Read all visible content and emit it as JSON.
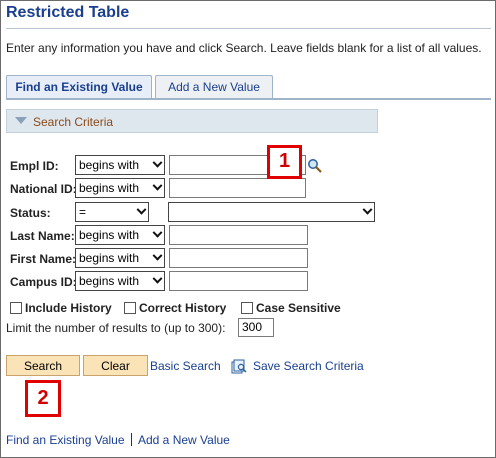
{
  "page": {
    "title": "Restricted Table",
    "instructions": "Enter any information you have and click Search. Leave fields blank for a list of all values."
  },
  "tabs": [
    {
      "label": "Find an Existing Value"
    },
    {
      "label": "Add a New Value"
    }
  ],
  "section": {
    "label": "Search Criteria"
  },
  "fields": {
    "empl_id": {
      "label": "Empl ID:",
      "operator": "begins with",
      "value": ""
    },
    "national_id": {
      "label": "National ID:",
      "operator": "begins with",
      "value": ""
    },
    "status": {
      "label": "Status:",
      "operator": "=",
      "value": ""
    },
    "last_name": {
      "label": "Last Name:",
      "operator": "begins with",
      "value": ""
    },
    "first_name": {
      "label": "First Name:",
      "operator": "begins with",
      "value": ""
    },
    "campus_id": {
      "label": "Campus ID:",
      "operator": "begins with",
      "value": ""
    }
  },
  "checkboxes": [
    {
      "label": "Include History",
      "checked": false
    },
    {
      "label": "Correct History",
      "checked": false
    },
    {
      "label": "Case Sensitive",
      "checked": false
    }
  ],
  "limit": {
    "label": "Limit the number of results to (up to 300):",
    "value": "300"
  },
  "buttons": {
    "search": "Search",
    "clear": "Clear"
  },
  "links": {
    "basic_search": "Basic Search",
    "save_criteria": "Save Search Criteria"
  },
  "footer": {
    "find_existing": "Find an Existing Value",
    "add_new": "Add a New Value"
  },
  "callouts": {
    "one": "1",
    "two": "2"
  },
  "icons": {
    "lookup": "magnifier-lookup-icon",
    "save": "save-search-icon"
  },
  "colors": {
    "title": "#1a3f8f",
    "link": "#1a3f8f",
    "button_bg": "#fbe3b8",
    "callout": "#e00000",
    "section_label": "#8a4a1a"
  }
}
